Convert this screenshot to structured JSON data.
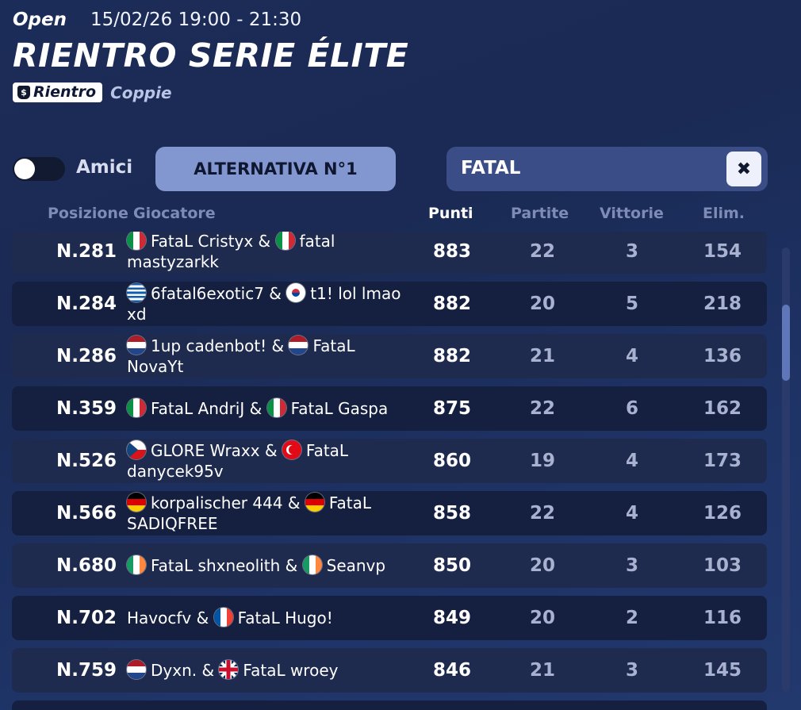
{
  "event": {
    "mode": "Open",
    "datetime": "15/02/26 19:00 - 21:30",
    "title": "RIENTRO SERIE ÉLITE",
    "tag_badge": "Rientro",
    "bag_icon": "money-bag-icon",
    "tag_plain": "Coppie"
  },
  "controls": {
    "friends_toggle_label": "Amici",
    "friends_toggle_on": false,
    "alternative_button": "ALTERNATIVA N°1",
    "search_value": "FATAL",
    "clear_icon": "close-icon"
  },
  "columns": {
    "position": "Posizione",
    "player": "Giocatore",
    "points": "Punti",
    "matches": "Partite",
    "wins": "Vittorie",
    "elims": "Elim."
  },
  "rows": [
    {
      "pos": "N.281",
      "p1_flag": "it",
      "p1": "FataL Cristyx",
      "p2_flag": "it",
      "p2": "fatal mastyzarkk",
      "points": "883",
      "matches": "22",
      "wins": "3",
      "elims": "154"
    },
    {
      "pos": "N.284",
      "p1_flag": "gr",
      "p1": "6fatal6exotic7",
      "p2_flag": "kr",
      "p2": "t1! lol lmao xd",
      "points": "882",
      "matches": "20",
      "wins": "5",
      "elims": "218"
    },
    {
      "pos": "N.286",
      "p1_flag": "nl",
      "p1": "1up cadenbot!",
      "p2_flag": "nl",
      "p2": "FataL NovaYt",
      "points": "882",
      "matches": "21",
      "wins": "4",
      "elims": "136"
    },
    {
      "pos": "N.359",
      "p1_flag": "it",
      "p1": "FataL AndriJ",
      "p2_flag": "it",
      "p2": "FataL Gaspa",
      "points": "875",
      "matches": "22",
      "wins": "6",
      "elims": "162"
    },
    {
      "pos": "N.526",
      "p1_flag": "cz",
      "p1": "GLORE Wraxx",
      "p2_flag": "tr",
      "p2": "FataL danycek95v",
      "points": "860",
      "matches": "19",
      "wins": "4",
      "elims": "173"
    },
    {
      "pos": "N.566",
      "p1_flag": "de",
      "p1": "korpalischer 444",
      "p2_flag": "de",
      "p2": "FataL SADIQFREE",
      "points": "858",
      "matches": "22",
      "wins": "4",
      "elims": "126"
    },
    {
      "pos": "N.680",
      "p1_flag": "ie",
      "p1": "FataL shxneolith",
      "p2_flag": "ie",
      "p2": "Seanvp",
      "points": "850",
      "matches": "20",
      "wins": "3",
      "elims": "103"
    },
    {
      "pos": "N.702",
      "p1_flag": "",
      "p1": "Havocfv",
      "p2_flag": "fr",
      "p2": "FataL Hugo!",
      "points": "849",
      "matches": "20",
      "wins": "2",
      "elims": "116"
    },
    {
      "pos": "N.759",
      "p1_flag": "nl",
      "p1": "Dyxn.",
      "p2_flag": "gb",
      "p2": "FataL wroey",
      "points": "846",
      "matches": "21",
      "wins": "3",
      "elims": "145"
    }
  ]
}
